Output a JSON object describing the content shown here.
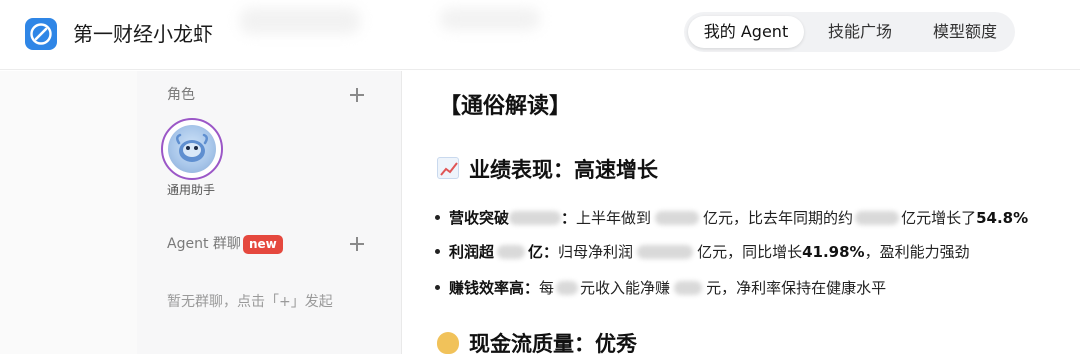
{
  "app": {
    "title": "第一财经小龙虾"
  },
  "tabs": [
    "我的 Agent",
    "技能广场",
    "模型额度"
  ],
  "sidebar": {
    "roles_label": "角色",
    "assistant_name": "通用助手",
    "group_label": "Agent 群聊",
    "new_badge": "new",
    "empty_hint": "暂无群聊，点击「+」发起"
  },
  "content": {
    "heading": "【通俗解读】",
    "section1_title": "业绩表现：高速增长",
    "b1_label": "营收突破",
    "b1_colon": "：",
    "b1_text1": "上半年做到",
    "b1_text2": "亿元，比去年同期的约",
    "b1_text3": "亿元增长了",
    "b1_value": "54.8%",
    "b2_label1": "利润超",
    "b2_label2": "亿",
    "b2_colon": "：",
    "b2_text1": "归母净利润",
    "b2_text2": "亿元，同比增长",
    "b2_value": "41.98%",
    "b2_text3": "，盈利能力强劲",
    "b3_label": "赚钱效率高",
    "b3_colon": "：",
    "b3_text1": "每",
    "b3_text2": "元收入能净赚",
    "b3_text3": "元，净利率保持在健康水平",
    "section2_title": "现金流质量：优秀"
  },
  "icons": {
    "logo": "app-logo-icon",
    "plus": "plus-icon",
    "section1_emoji": "chart-increasing-icon",
    "section2_emoji": "money-bag-icon"
  },
  "colors": {
    "accent": "#2f86e6",
    "badge": "#e5483e",
    "avatar_ring": "#9b57c7"
  }
}
